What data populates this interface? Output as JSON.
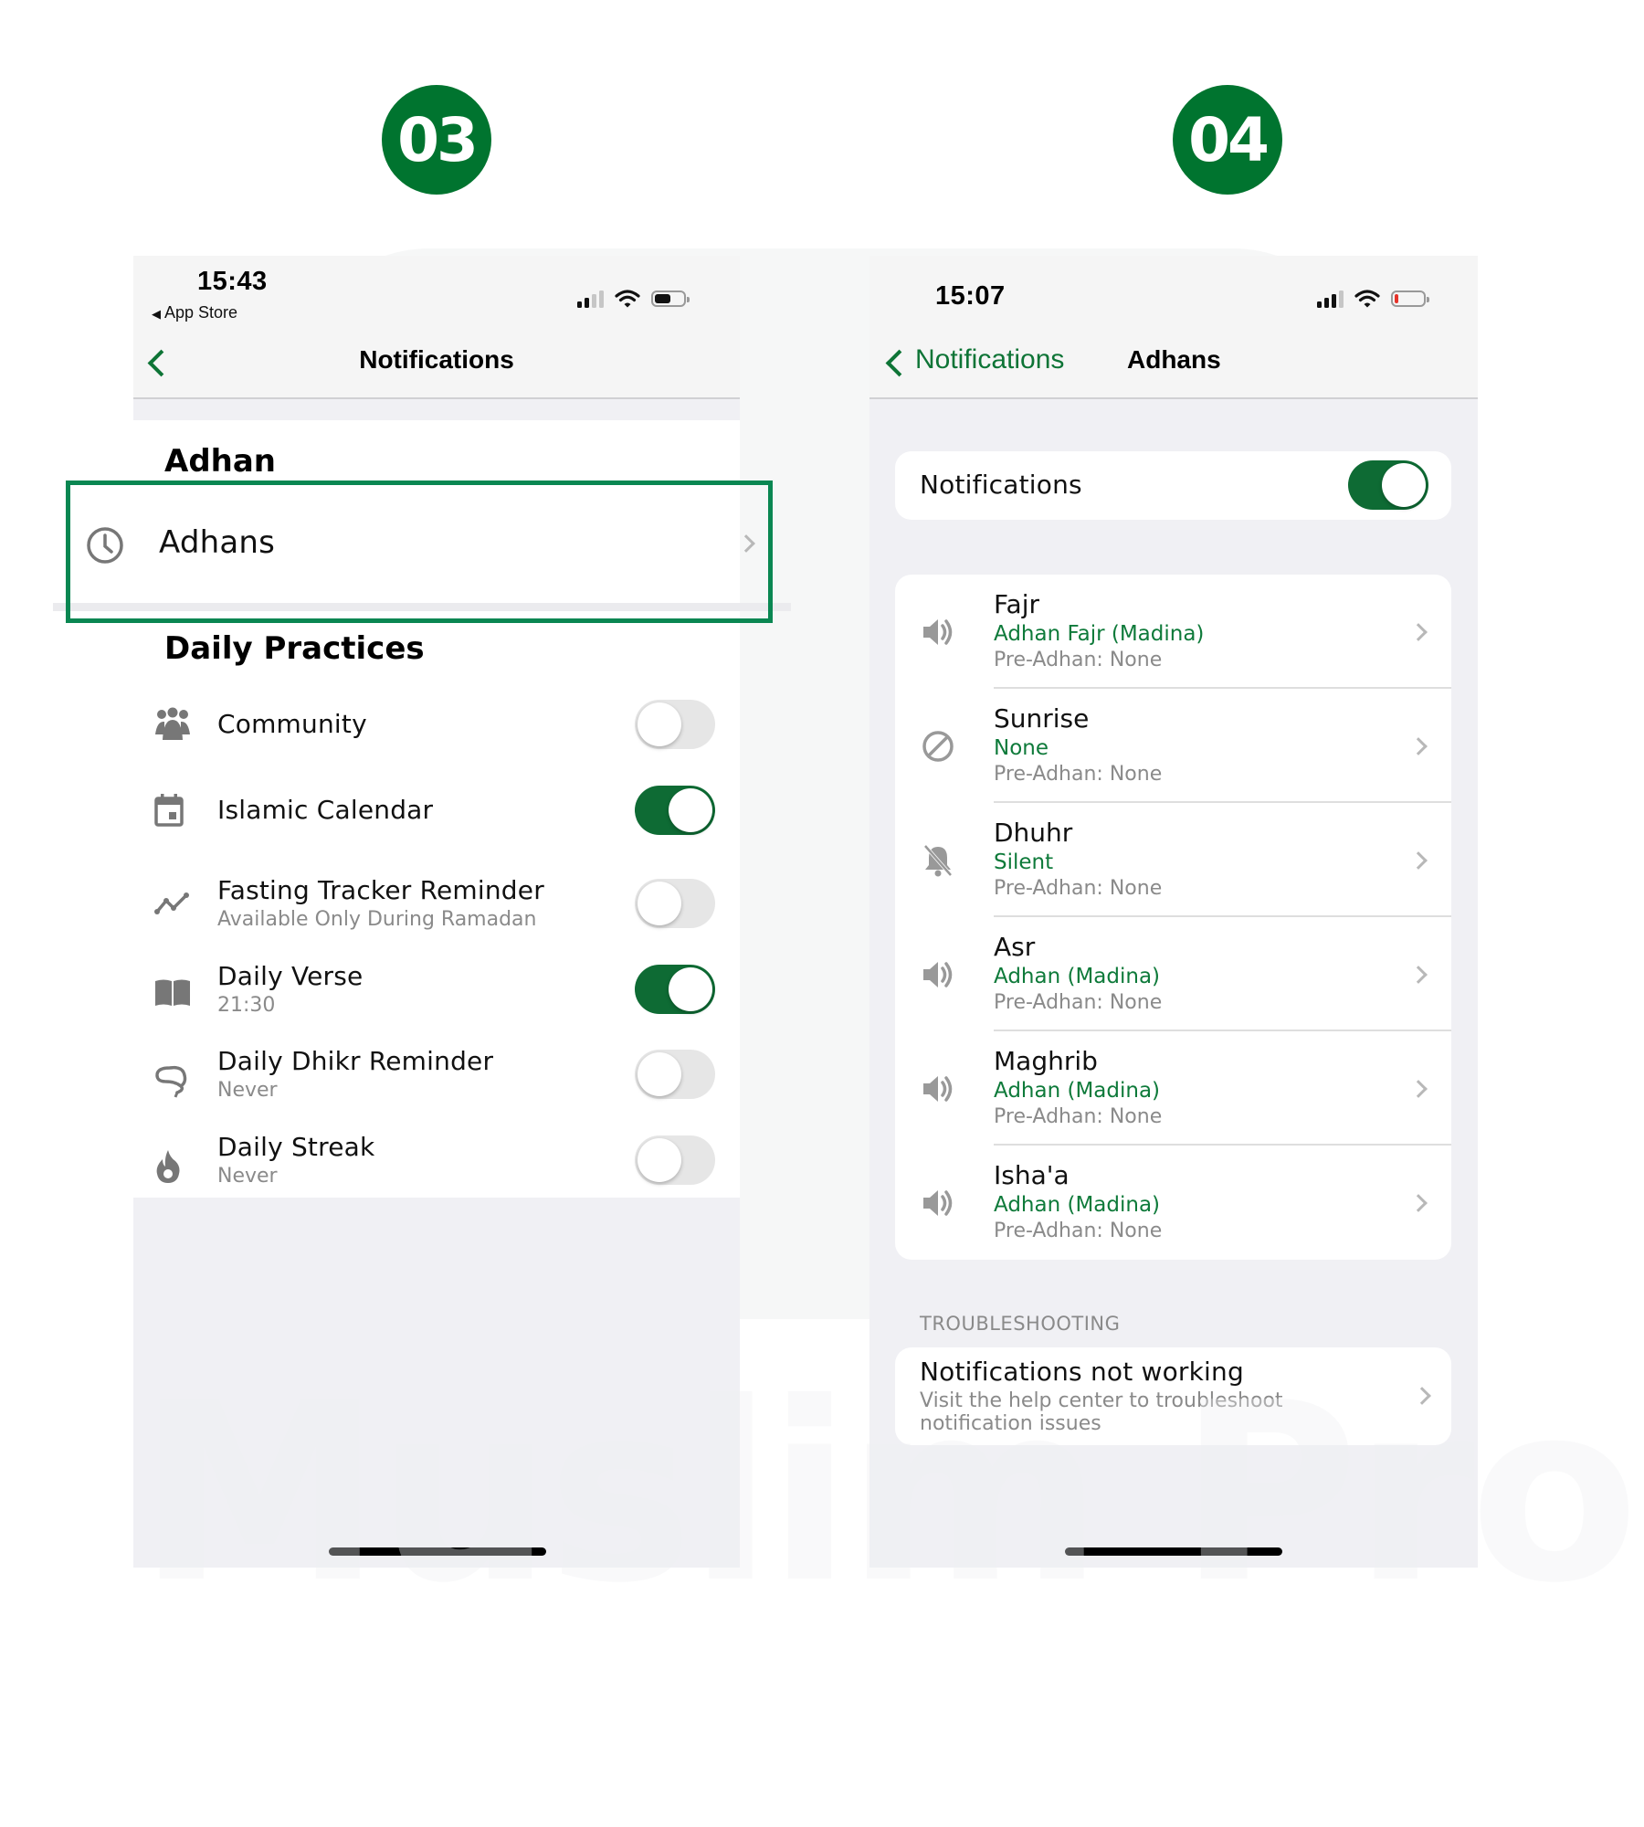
{
  "steps": {
    "left_badge": "03",
    "right_badge": "04"
  },
  "watermark": "Muslim Pro",
  "colors": {
    "brand_green": "#00742F",
    "toggle_on": "#0E6B34",
    "highlight_border": "#0A8752",
    "link_green": "#0E7A3A",
    "battery_low": "#E5332A"
  },
  "screen_left": {
    "status": {
      "time": "15:43",
      "back_app": "App Store",
      "back_app_icon": "triangle-left-icon",
      "signal_bars_on": 2,
      "signal_bars_total": 4,
      "battery_level": 0.55
    },
    "nav": {
      "back_icon": "chevron-left-icon",
      "title": "Notifications"
    },
    "adhan_section": {
      "header": "Adhan",
      "row": {
        "icon": "clock-icon",
        "label": "Adhans",
        "chevron_icon": "chevron-right-icon",
        "highlighted": true
      }
    },
    "daily_section": {
      "header": "Daily Practices",
      "items": [
        {
          "icon": "community-icon",
          "title": "Community",
          "subtitle": "",
          "enabled": false
        },
        {
          "icon": "calendar-icon",
          "title": "Islamic Calendar",
          "subtitle": "",
          "enabled": true
        },
        {
          "icon": "trend-line-icon",
          "title": "Fasting Tracker Reminder",
          "subtitle": "Available Only During Ramadan",
          "enabled": false
        },
        {
          "icon": "book-icon",
          "title": "Daily Verse",
          "subtitle": "21:30",
          "enabled": true
        },
        {
          "icon": "prayer-beads-icon",
          "title": "Daily Dhikr Reminder",
          "subtitle": "Never",
          "enabled": false
        },
        {
          "icon": "flame-icon",
          "title": "Daily Streak",
          "subtitle": "Never",
          "enabled": false
        }
      ]
    }
  },
  "screen_right": {
    "status": {
      "time": "15:07",
      "signal_bars_on": 3,
      "signal_bars_total": 4,
      "battery_level": 0.12
    },
    "nav": {
      "back_icon": "chevron-left-icon",
      "back_label": "Notifications",
      "title": "Adhans"
    },
    "master_toggle": {
      "label": "Notifications",
      "enabled": true
    },
    "prayers": [
      {
        "icon": "speaker-icon",
        "name": "Fajr",
        "sound": "Adhan Fajr (Madina)",
        "pre_adhan": "Pre-Adhan: None"
      },
      {
        "icon": "prohibited-icon",
        "name": "Sunrise",
        "sound": "None",
        "pre_adhan": "Pre-Adhan: None"
      },
      {
        "icon": "bell-slash-icon",
        "name": "Dhuhr",
        "sound": "Silent",
        "pre_adhan": "Pre-Adhan: None"
      },
      {
        "icon": "speaker-icon",
        "name": "Asr",
        "sound": "Adhan (Madina)",
        "pre_adhan": "Pre-Adhan: None"
      },
      {
        "icon": "speaker-icon",
        "name": "Maghrib",
        "sound": "Adhan (Madina)",
        "pre_adhan": "Pre-Adhan: None"
      },
      {
        "icon": "speaker-icon",
        "name": "Isha'a",
        "sound": "Adhan (Madina)",
        "pre_adhan": "Pre-Adhan: None"
      }
    ],
    "troubleshooting": {
      "section_label": "TROUBLESHOOTING",
      "title": "Notifications not working",
      "subtitle_line1": "Visit the help center to troubleshoot",
      "subtitle_line2": "notification issues"
    }
  }
}
